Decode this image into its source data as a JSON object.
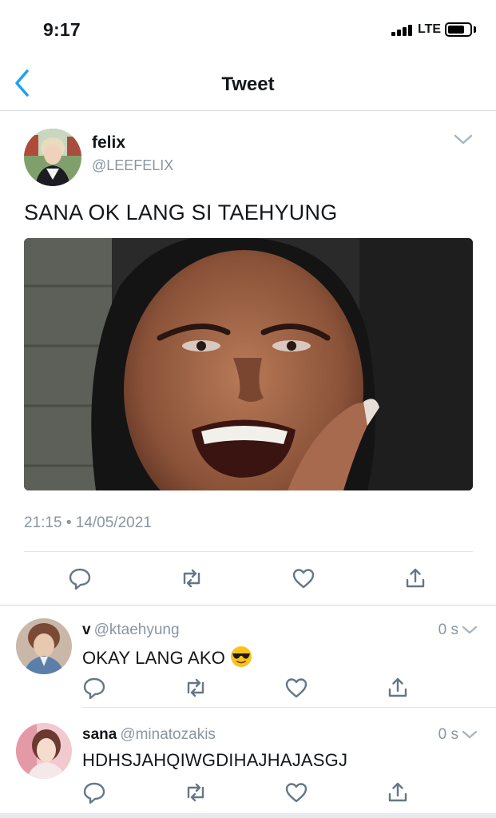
{
  "status_bar": {
    "time": "9:17",
    "network": "LTE",
    "signal_bars": 4,
    "battery_level": 0.7
  },
  "nav": {
    "title": "Tweet",
    "back_icon": "chevron-left-icon",
    "accent_color": "#1da1f2"
  },
  "tweet": {
    "name": "felix",
    "handle": "@LEEFELIX",
    "text": "SANA OK LANG SI TAEHYUNG",
    "timestamp": "21:15 • 14/05/2021",
    "actions": [
      "reply-icon",
      "retweet-icon",
      "like-icon",
      "share-icon"
    ]
  },
  "replies": [
    {
      "name": "v",
      "handle": "@ktaehyung",
      "time": "0 s",
      "text": "OKAY LANG AKO",
      "emoji": "sunglasses-emoji"
    },
    {
      "name": "sana",
      "handle": "@minatozakis",
      "time": "0 s",
      "text": "HDHSJAHQIWGDIHAJHAJASGJ"
    }
  ],
  "colors": {
    "text": "#14171a",
    "secondary": "#8a96a1",
    "icon": "#657786",
    "divider": "#e1e5e8"
  }
}
